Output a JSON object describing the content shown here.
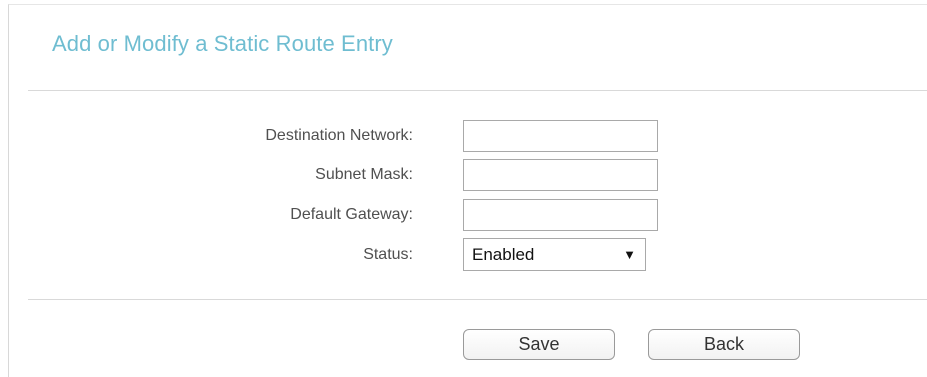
{
  "title": "Add or Modify a Static Route Entry",
  "form": {
    "destination_network": {
      "label": "Destination Network:",
      "value": ""
    },
    "subnet_mask": {
      "label": "Subnet Mask:",
      "value": ""
    },
    "default_gateway": {
      "label": "Default Gateway:",
      "value": ""
    },
    "status": {
      "label": "Status:",
      "selected": "Enabled",
      "arrow_icon": "triangle-down-icon"
    }
  },
  "buttons": {
    "save_label": "Save",
    "back_label": "Back"
  },
  "colors": {
    "title": "#6fbdd1",
    "rule": "#d9d9d9",
    "border": "#a9a9a9"
  }
}
